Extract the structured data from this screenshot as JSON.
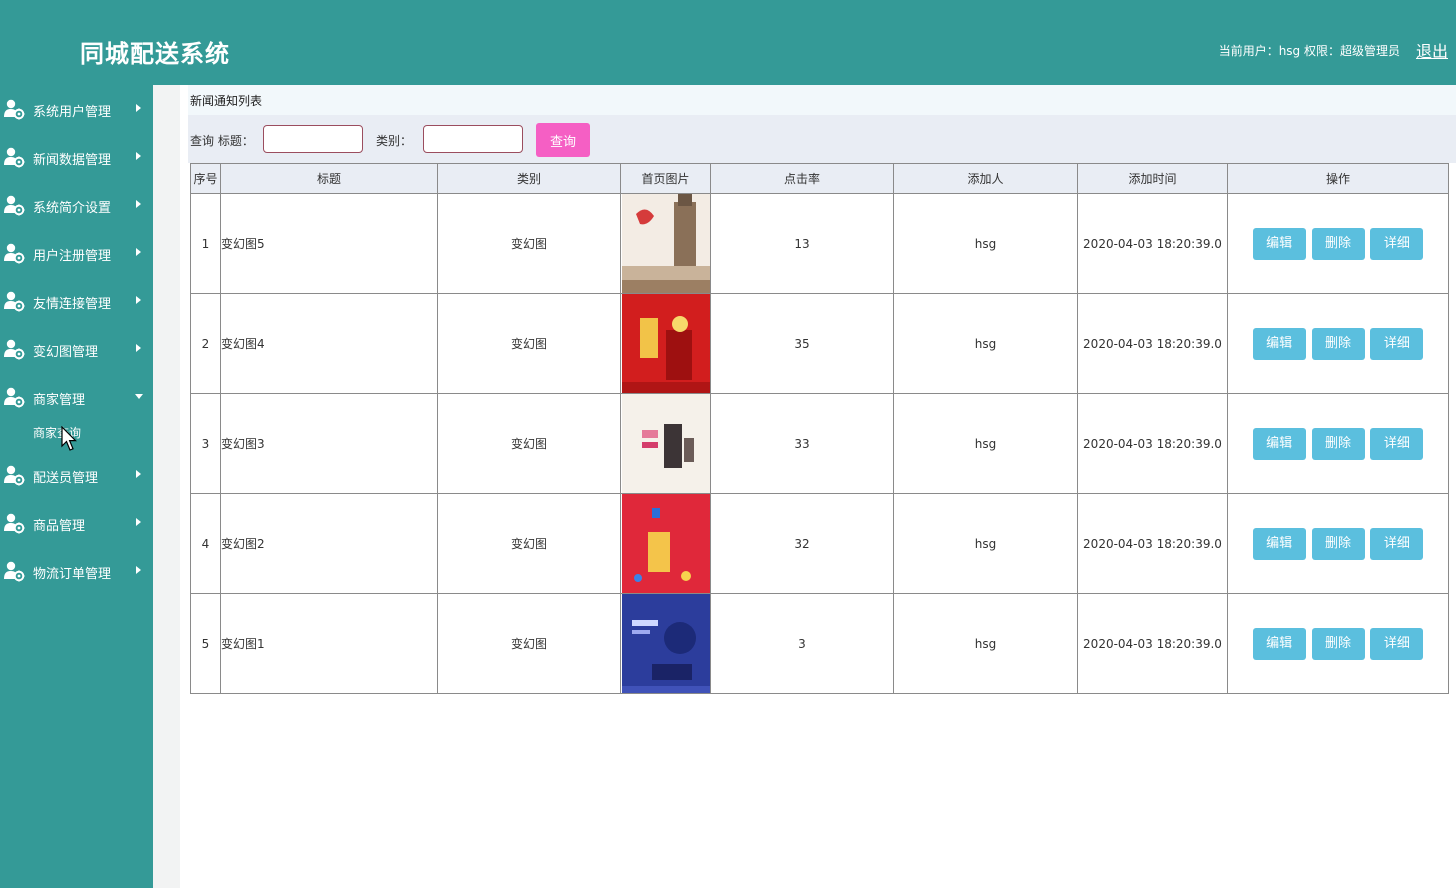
{
  "header": {
    "title": "同城配送系统",
    "user_info": "当前用户：hsg  权限：超级管理员",
    "logout": "退出"
  },
  "sidebar": {
    "items": [
      {
        "label": "系统用户管理",
        "icon": "user-gear-icon",
        "expanded": false
      },
      {
        "label": "新闻数据管理",
        "icon": "user-gear-icon",
        "expanded": false
      },
      {
        "label": "系统简介设置",
        "icon": "user-gear-icon",
        "expanded": false
      },
      {
        "label": "用户注册管理",
        "icon": "user-gear-icon",
        "expanded": false
      },
      {
        "label": "友情连接管理",
        "icon": "user-gear-icon",
        "expanded": false
      },
      {
        "label": "变幻图管理",
        "icon": "user-gear-icon",
        "expanded": false
      },
      {
        "label": "商家管理",
        "icon": "user-gear-icon",
        "expanded": true
      },
      {
        "label": "配送员管理",
        "icon": "user-gear-icon",
        "expanded": false
      },
      {
        "label": "商品管理",
        "icon": "user-gear-icon",
        "expanded": false
      },
      {
        "label": "物流订单管理",
        "icon": "user-gear-icon",
        "expanded": false
      }
    ],
    "submenu": "商家查询"
  },
  "main": {
    "breadcrumb": "新闻通知列表",
    "query": {
      "prefix": "查询 标题：",
      "category_label": "类别：",
      "title_value": "",
      "category_value": "",
      "button": "查询"
    },
    "columns": [
      "序号",
      "标题",
      "类别",
      "首页图片",
      "点击率",
      "添加人",
      "添加时间",
      "操作"
    ],
    "rows": [
      {
        "no": "1",
        "title": "变幻图5",
        "category": "变幻图",
        "clicks": "13",
        "adder": "hsg",
        "time": "2020-04-03 18:20:39.0",
        "image": "banner-palace"
      },
      {
        "no": "2",
        "title": "变幻图4",
        "category": "变幻图",
        "clicks": "35",
        "adder": "hsg",
        "time": "2020-04-03 18:20:39.0",
        "image": "banner-red-festival"
      },
      {
        "no": "3",
        "title": "变幻图3",
        "category": "变幻图",
        "clicks": "33",
        "adder": "hsg",
        "time": "2020-04-03 18:20:39.0",
        "image": "banner-light-product"
      },
      {
        "no": "4",
        "title": "变幻图2",
        "category": "变幻图",
        "clicks": "32",
        "adder": "hsg",
        "time": "2020-04-03 18:20:39.0",
        "image": "banner-red-sale"
      },
      {
        "no": "5",
        "title": "变幻图1",
        "category": "变幻图",
        "clicks": "3",
        "adder": "hsg",
        "time": "2020-04-03 18:20:39.0",
        "image": "banner-blue-tech"
      }
    ],
    "actions": [
      "编辑",
      "删除",
      "详细"
    ]
  },
  "colors": {
    "sidebar": "#349a97",
    "query_button": "#f55fc4",
    "action_button": "#5bbfde",
    "input_border": "#9b4d5e"
  }
}
